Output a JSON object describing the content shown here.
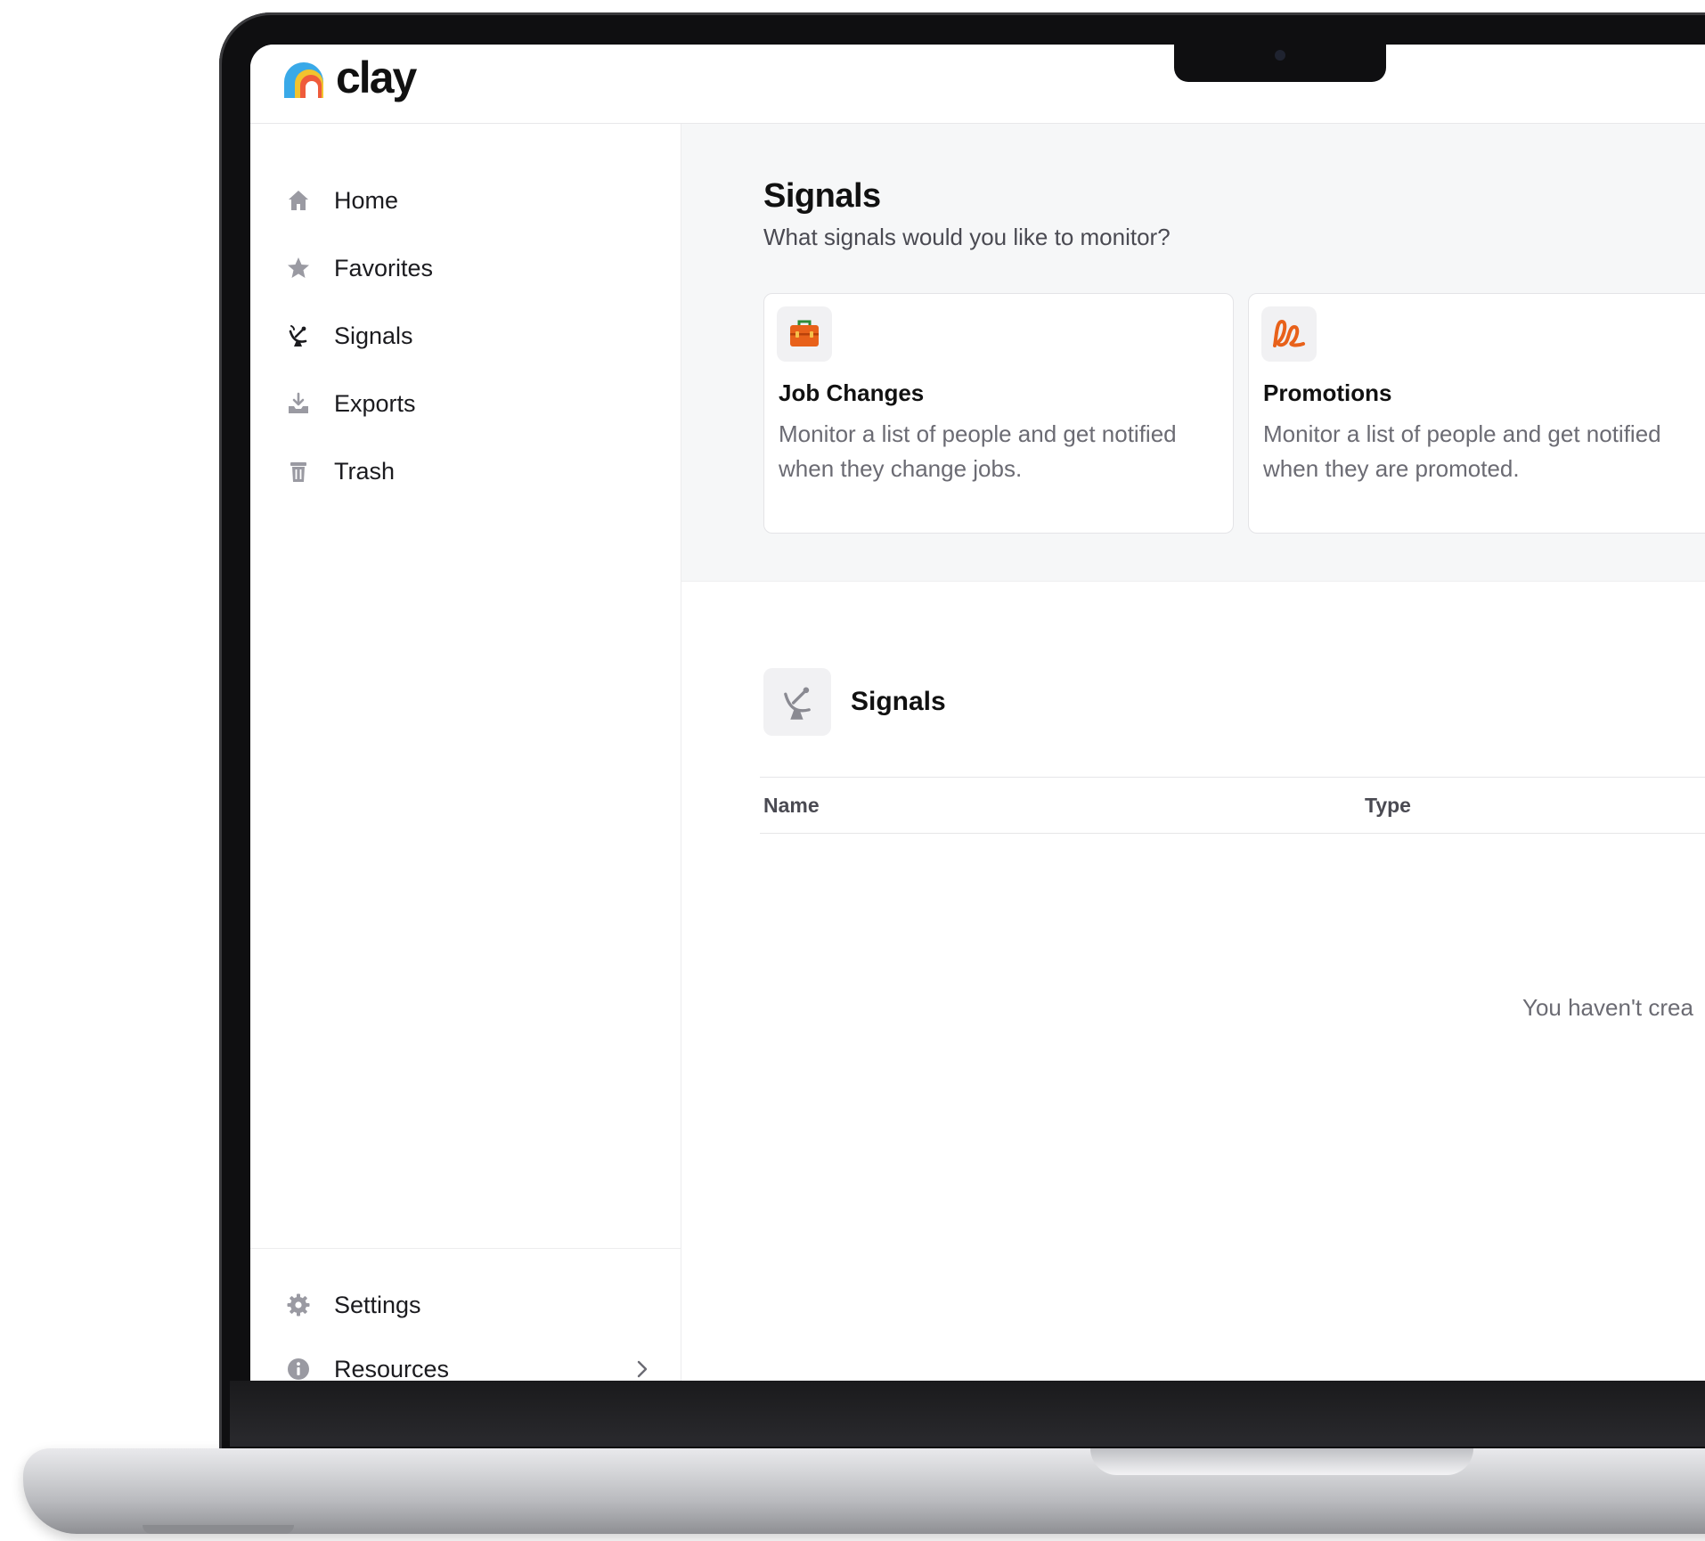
{
  "app": {
    "logo_text": "clay"
  },
  "sidebar": {
    "items": [
      {
        "label": "Home",
        "icon": "home-icon"
      },
      {
        "label": "Favorites",
        "icon": "star-icon"
      },
      {
        "label": "Signals",
        "icon": "satellite-dish-icon"
      },
      {
        "label": "Exports",
        "icon": "export-tray-icon"
      },
      {
        "label": "Trash",
        "icon": "trash-icon"
      }
    ],
    "bottom_items": [
      {
        "label": "Settings",
        "icon": "gear-icon"
      },
      {
        "label": "Resources",
        "icon": "info-icon",
        "chevron": "chevron-right-icon"
      }
    ]
  },
  "main": {
    "title": "Signals",
    "subtitle": "What signals would you like to monitor?",
    "cards": [
      {
        "title": "Job Changes",
        "description": "Monitor a list of people and get notified when they change jobs.",
        "icon": "briefcase-icon"
      },
      {
        "title": "Promotions",
        "description": "Monitor a list of people and get notified when they are promoted.",
        "icon": "loop-ribbon-icon"
      }
    ],
    "list": {
      "title": "Signals",
      "icon": "satellite-dish-icon",
      "columns": [
        "Name",
        "Type"
      ],
      "empty_text": "You haven't crea"
    }
  },
  "colors": {
    "accent_orange": "#e8611a",
    "sidebar_icon_gray": "#9a9aa2",
    "hero_background": "#f6f7f8"
  }
}
